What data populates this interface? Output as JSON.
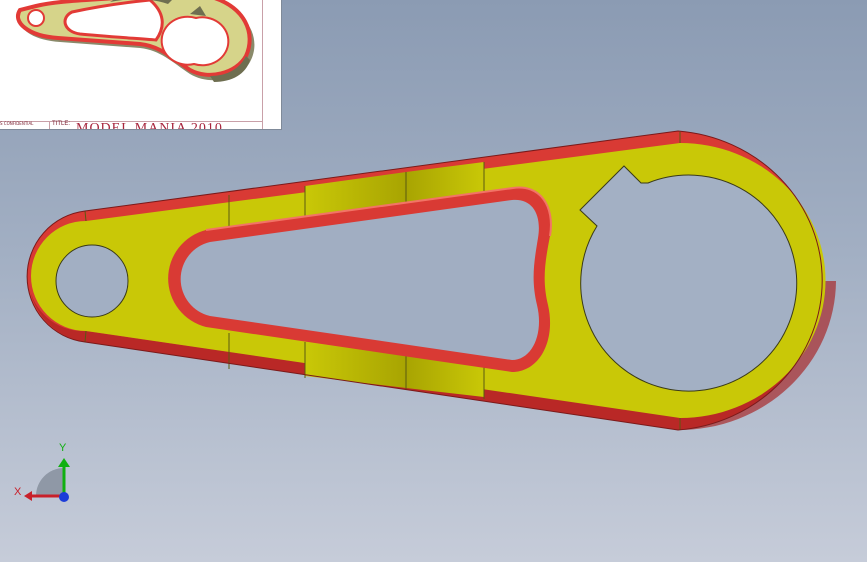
{
  "thumbnail": {
    "title_label": "TITLE:",
    "title_text": "MODEL MANIA 2010",
    "confidential_text": "S CONFIDENTIAL"
  },
  "triad": {
    "x_label": "X",
    "y_label": "Y"
  },
  "colors": {
    "face_yellow": "#c9c807",
    "face_shaded": "#aca800",
    "edge_red": "#e8403b",
    "edge_dark_red": "#b32424",
    "axis_x": "#c8202a",
    "axis_y": "#10b010",
    "axis_z": "#1c3cd8"
  }
}
